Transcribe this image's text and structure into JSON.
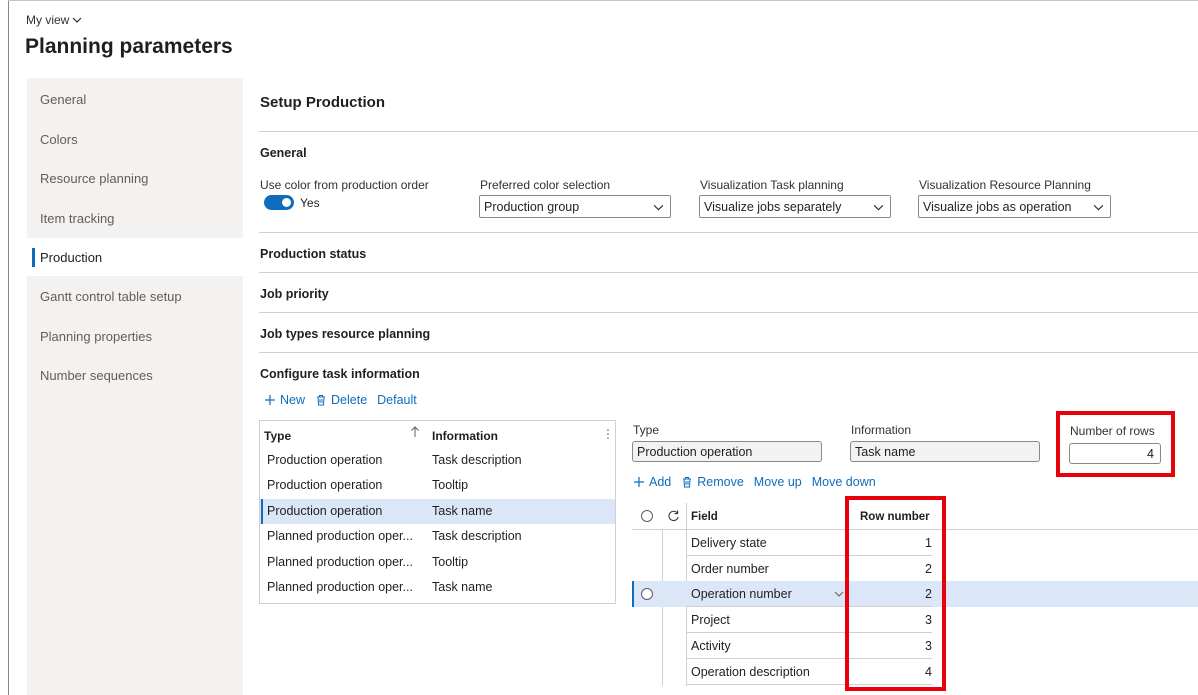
{
  "header": {
    "my_view": "My view",
    "title": "Planning parameters"
  },
  "sidebar": {
    "items": [
      {
        "label": "General"
      },
      {
        "label": "Colors"
      },
      {
        "label": "Resource planning"
      },
      {
        "label": "Item tracking"
      },
      {
        "label": "Production"
      },
      {
        "label": "Gantt control table setup"
      },
      {
        "label": "Planning properties"
      },
      {
        "label": "Number sequences"
      }
    ],
    "active": "Production"
  },
  "main": {
    "title": "Setup Production",
    "sections": {
      "general": "General",
      "production_status": "Production status",
      "job_priority": "Job priority",
      "job_types": "Job types resource planning",
      "configure": "Configure task information"
    },
    "general": {
      "use_color_label": "Use color from production order",
      "use_color_value": "Yes",
      "preferred_label": "Preferred color selection",
      "preferred_value": "Production group",
      "vis_task_label": "Visualization Task planning",
      "vis_task_value": "Visualize jobs separately",
      "vis_res_label": "Visualization Resource Planning",
      "vis_res_value": "Visualize jobs as operation"
    },
    "toolbar": {
      "new": "New",
      "delete": "Delete",
      "default": "Default"
    },
    "grid": {
      "col_type": "Type",
      "col_info": "Information",
      "rows": [
        {
          "type": "Production operation",
          "info": "Task description"
        },
        {
          "type": "Production operation",
          "info": "Tooltip"
        },
        {
          "type": "Production operation",
          "info": "Task name"
        },
        {
          "type": "Planned production oper...",
          "info": "Task description"
        },
        {
          "type": "Planned production oper...",
          "info": "Tooltip"
        },
        {
          "type": "Planned production oper...",
          "info": "Task name"
        }
      ],
      "selected_index": 2
    },
    "detail": {
      "type_label": "Type",
      "type_value": "Production operation",
      "info_label": "Information",
      "info_value": "Task name",
      "rows_label": "Number of rows",
      "rows_value": "4",
      "toolbar": {
        "add": "Add",
        "remove": "Remove",
        "move_up": "Move up",
        "move_down": "Move down"
      },
      "col_field": "Field",
      "col_row_number": "Row number",
      "rows": [
        {
          "field": "Delivery state",
          "row": "1"
        },
        {
          "field": "Order number",
          "row": "2"
        },
        {
          "field": "Operation number",
          "row": "2"
        },
        {
          "field": "Project",
          "row": "3"
        },
        {
          "field": "Activity",
          "row": "3"
        },
        {
          "field": "Operation description",
          "row": "4"
        }
      ],
      "selected_index": 2
    }
  },
  "colors": {
    "accent": "#0f6cbd",
    "highlight": "#e8000b",
    "selected_row": "#dbe7f8"
  }
}
